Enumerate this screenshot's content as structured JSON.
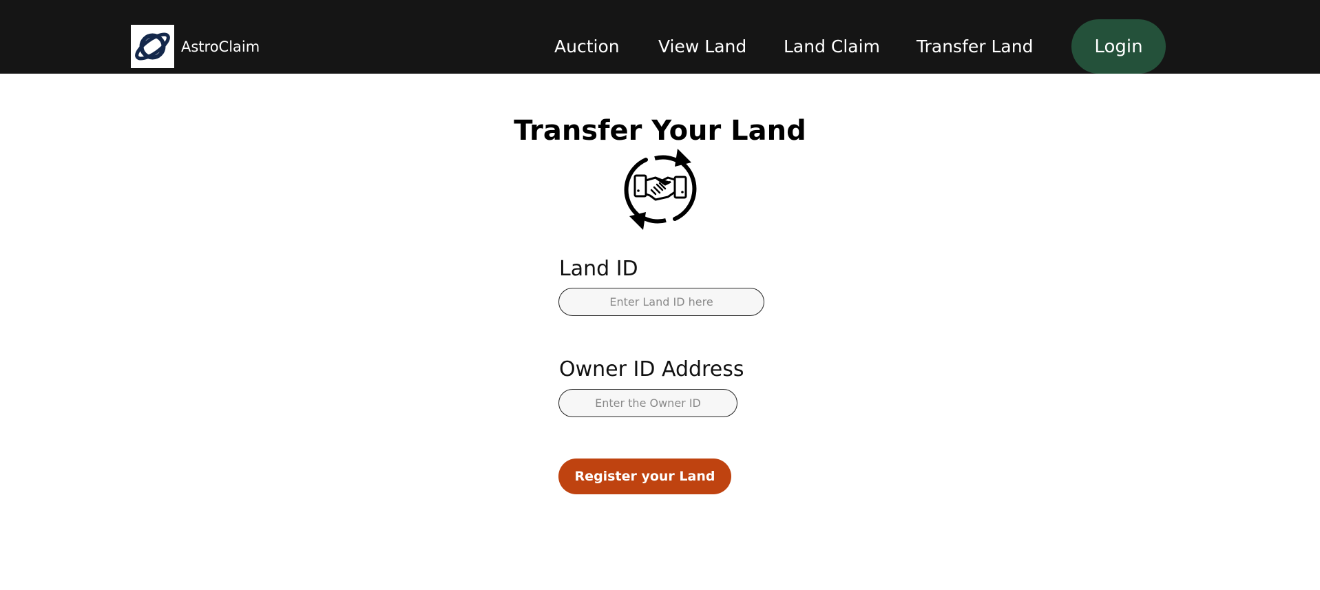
{
  "nav": {
    "brand": "AstroClaim",
    "links": [
      "Auction",
      "View Land",
      "Land Claim",
      "Transfer Land"
    ],
    "login_label": "Login"
  },
  "main": {
    "title": "Transfer Your Land",
    "icon": "handshake-transfer-icon",
    "form": {
      "land_id_label": "Land ID",
      "land_id_placeholder": "Enter Land ID here",
      "land_id_value": "",
      "owner_label": "Owner ID Address",
      "owner_placeholder": "Enter the Owner ID",
      "owner_value": "",
      "submit_label": "Register your Land"
    }
  },
  "colors": {
    "navbar": "#151515",
    "login_button": "#24513a",
    "submit_button": "#bf4310",
    "logo_planet": "#14284b"
  }
}
